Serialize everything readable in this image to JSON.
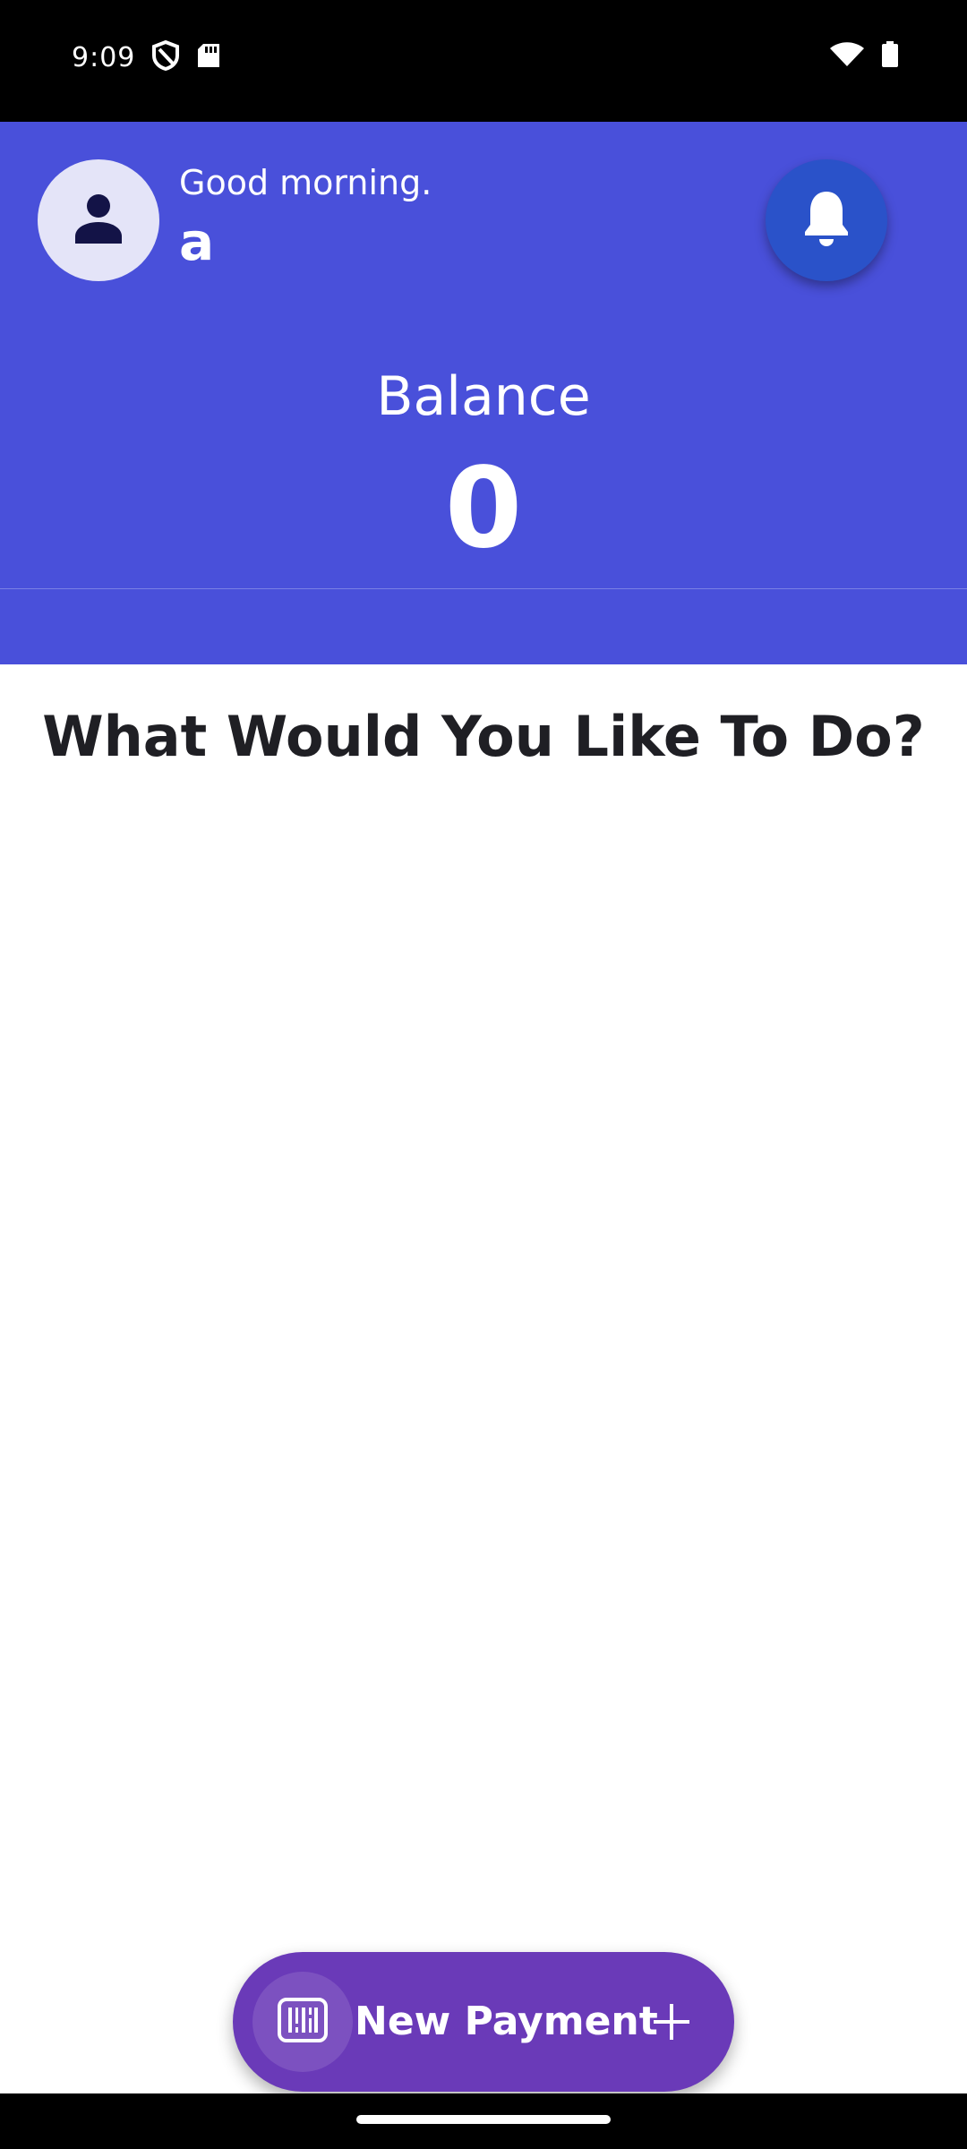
{
  "status_bar": {
    "time": "9:09",
    "icons": [
      "shield-icon",
      "sd-card-icon",
      "wifi-icon",
      "battery-icon"
    ]
  },
  "header": {
    "greeting": "Good morning.",
    "username": "a",
    "avatar_icon": "person-icon",
    "notification_icon": "bell-icon",
    "balance_label": "Balance",
    "balance_value": "0",
    "background_color": "#4950da"
  },
  "main": {
    "section_title": "What Would You Like To Do?"
  },
  "fab": {
    "label": "New Payment",
    "icon": "barcode-icon",
    "trailing_icon": "plus-icon",
    "background_color": "#6a3ab8"
  }
}
